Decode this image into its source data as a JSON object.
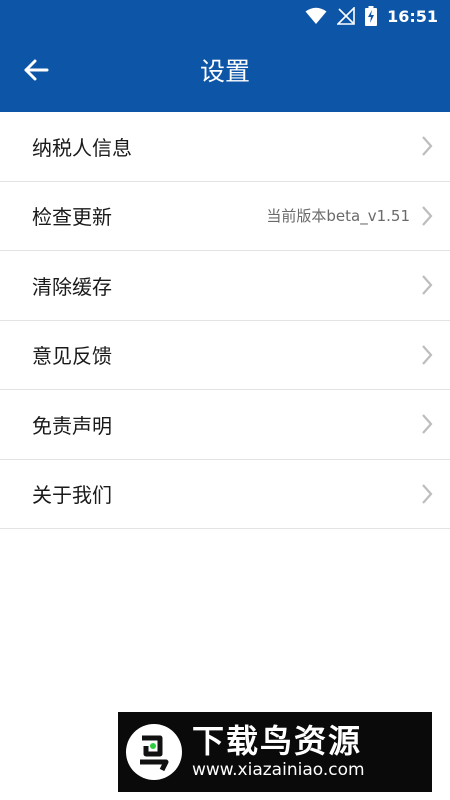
{
  "status_bar": {
    "time": "16:51",
    "icons": [
      "wifi-icon",
      "no-signal-icon",
      "battery-charging-icon"
    ]
  },
  "header": {
    "title": "设置",
    "back_icon": "arrow-left-icon"
  },
  "settings": {
    "items": [
      {
        "label": "纳税人信息",
        "value": ""
      },
      {
        "label": "检查更新",
        "value": "当前版本beta_v1.51"
      },
      {
        "label": "清除缓存",
        "value": ""
      },
      {
        "label": "意见反馈",
        "value": ""
      },
      {
        "label": "免责声明",
        "value": ""
      },
      {
        "label": "关于我们",
        "value": ""
      }
    ],
    "chevron_icon": "chevron-right-icon"
  },
  "watermark": {
    "brand": "下载鸟资源",
    "url": "www.xiazainiao.com"
  },
  "colors": {
    "header_bg": "#0d55a6",
    "divider": "#e3e3e3",
    "chevron": "#bdbdbd",
    "secondary_text": "#6a6a6a"
  }
}
